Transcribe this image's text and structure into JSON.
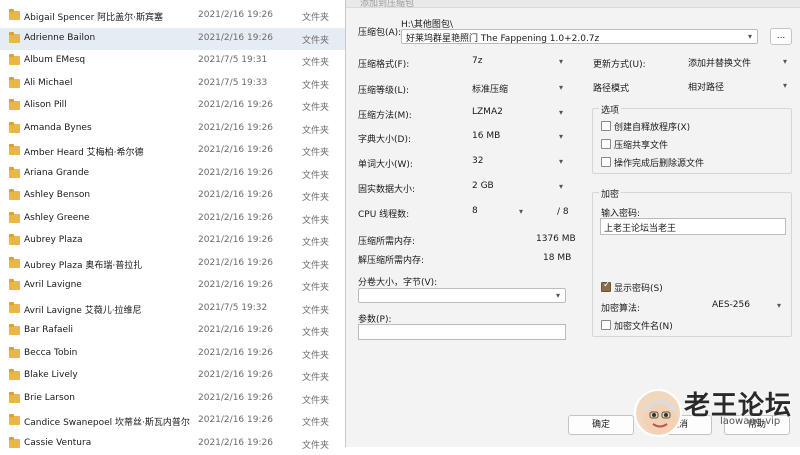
{
  "explorer": {
    "type_label": "文件夹",
    "rows": [
      {
        "name": "Abigail Spencer 阿比盖尔·斯宾塞",
        "date": "2021/2/16 19:26"
      },
      {
        "name": "Adrienne Bailon",
        "date": "2021/2/16 19:26",
        "selected": true
      },
      {
        "name": "Album EMesq",
        "date": "2021/7/5 19:31"
      },
      {
        "name": "Ali Michael",
        "date": "2021/7/5 19:33"
      },
      {
        "name": "Alison Pill",
        "date": "2021/2/16 19:26"
      },
      {
        "name": "Amanda Bynes",
        "date": "2021/2/16 19:26"
      },
      {
        "name": "Amber Heard 艾梅柏·希尔德",
        "date": "2021/2/16 19:26"
      },
      {
        "name": "Ariana Grande",
        "date": "2021/2/16 19:26"
      },
      {
        "name": "Ashley Benson",
        "date": "2021/2/16 19:26"
      },
      {
        "name": "Ashley Greene",
        "date": "2021/2/16 19:26"
      },
      {
        "name": "Aubrey Plaza",
        "date": "2021/2/16 19:26"
      },
      {
        "name": "Aubrey Plaza 奥布瑞·普拉扎",
        "date": "2021/2/16 19:26"
      },
      {
        "name": "Avril Lavigne",
        "date": "2021/2/16 19:26"
      },
      {
        "name": "Avril Lavigne 艾薇儿·拉维尼",
        "date": "2021/7/5 19:32"
      },
      {
        "name": "Bar Rafaeli",
        "date": "2021/2/16 19:26"
      },
      {
        "name": "Becca Tobin",
        "date": "2021/2/16 19:26"
      },
      {
        "name": "Blake Lively",
        "date": "2021/2/16 19:26"
      },
      {
        "name": "Brie Larson",
        "date": "2021/2/16 19:26"
      },
      {
        "name": "Candice Swanepoel 坎蒂丝·斯瓦内普尔",
        "date": "2021/2/16 19:26"
      },
      {
        "name": "Cassie Ventura",
        "date": "2021/2/16 19:26"
      }
    ]
  },
  "dialog": {
    "title": "添加到压缩包",
    "archive_label": "压缩包(A):",
    "archive_path": "H:\\其他图包\\",
    "archive_name": "好莱坞群星艳照门 The Fappening 1.0+2.0.7z",
    "browse_label": "...",
    "format_label": "压缩格式(F):",
    "format_value": "7z",
    "level_label": "压缩等级(L):",
    "level_value": "标准压缩",
    "method_label": "压缩方法(M):",
    "method_value": "LZMA2",
    "dict_label": "字典大小(D):",
    "dict_value": "16 MB",
    "word_label": "单词大小(W):",
    "word_value": "32",
    "solid_label": "固实数据大小:",
    "solid_value": "2 GB",
    "threads_label": "CPU 线程数:",
    "threads_value": "8",
    "threads_max": "/ 8",
    "mem_comp_label": "压缩所需内存:",
    "mem_comp_value": "1376 MB",
    "mem_decomp_label": "解压缩所需内存:",
    "mem_decomp_value": "18 MB",
    "split_label": "分卷大小，字节(V):",
    "split_value": "",
    "params_label": "参数(P):",
    "update_label": "更新方式(U):",
    "update_value": "添加并替换文件",
    "pathmode_label": "路径模式",
    "pathmode_value": "相对路径",
    "options_title": "选项",
    "opt_sfx": "创建自释放程序(X)",
    "opt_shared": "压缩共享文件",
    "opt_delete": "操作完成后删除源文件",
    "enc_title": "加密",
    "enc_pw_label": "输入密码:",
    "enc_pw_value": "上老王论坛当老王",
    "show_pw_label": "显示密码(S)",
    "enc_method_label": "加密算法:",
    "enc_method_value": "AES-256",
    "enc_names_label": "加密文件名(N)",
    "ok_label": "确定",
    "cancel_label": "取消",
    "help_label": "帮助"
  },
  "watermark": {
    "text": "老王论坛",
    "url": "laowang.vip"
  },
  "colors": {
    "folder": "#e9b64a",
    "selection": "#e6ecf3",
    "dialog_bg": "#f3f3f3",
    "checkbox_checked": "#8a6d4a"
  }
}
